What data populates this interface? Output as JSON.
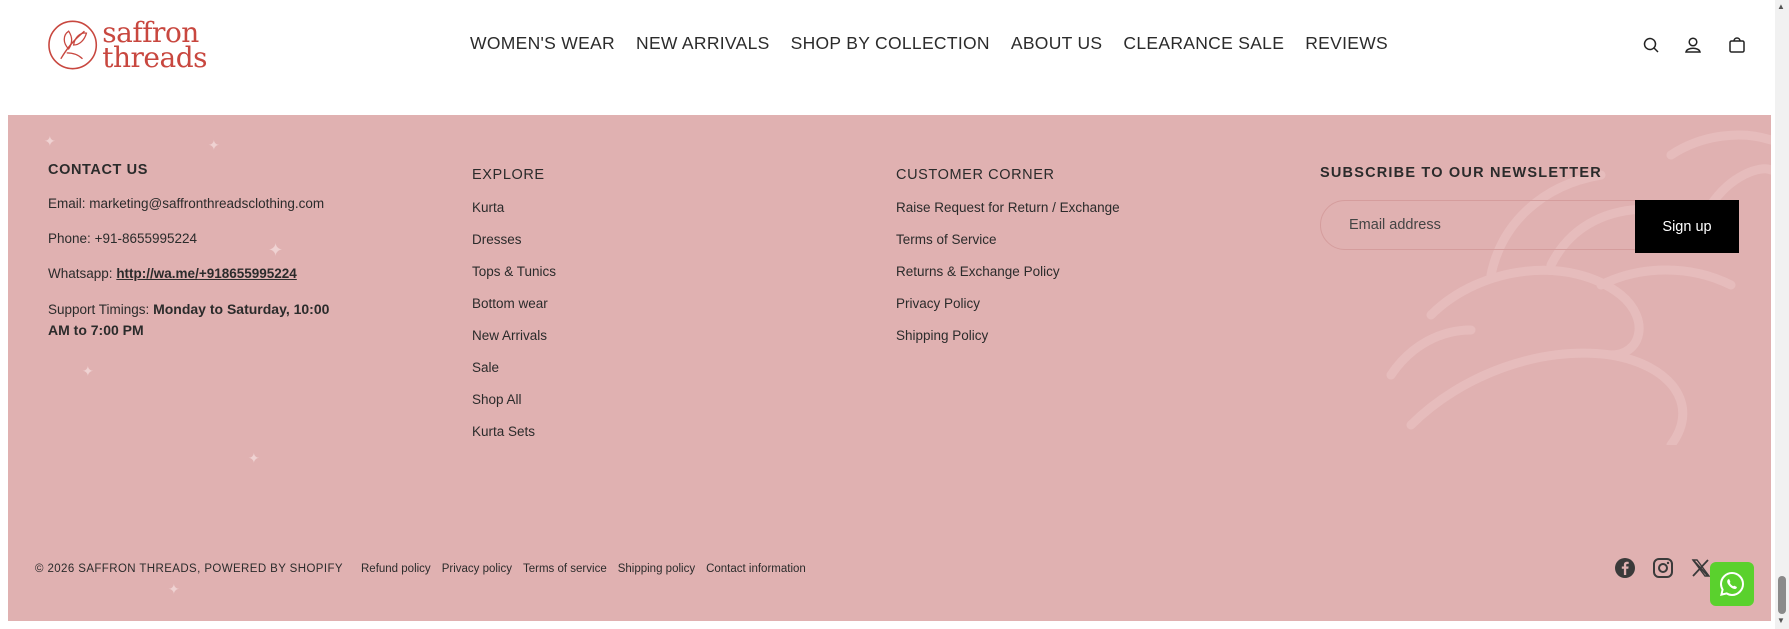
{
  "brand": {
    "line1": "saffron",
    "line2": "threads",
    "color": "#c8473f"
  },
  "nav": [
    "WOMEN'S WEAR",
    "NEW ARRIVALS",
    "SHOP BY COLLECTION",
    "ABOUT US",
    "CLEARANCE SALE",
    "REVIEWS"
  ],
  "header_icons": [
    "search-icon",
    "account-icon",
    "cart-icon"
  ],
  "contact": {
    "title": "CONTACT US",
    "email_label": "Email:",
    "email": "marketing@saffronthreadsclothing.com",
    "phone_label": "Phone:",
    "phone": "+91-8655995224",
    "whatsapp_label": "Whatsapp:",
    "whatsapp_link": "http://wa.me/+918655995224",
    "timings_label": "Support Timings:",
    "timings": "Monday to Saturday, 10:00 AM to 7:00 PM"
  },
  "explore": {
    "title": "EXPLORE",
    "links": [
      "Kurta",
      "Dresses",
      "Tops & Tunics",
      "Bottom wear",
      "New Arrivals",
      "Sale",
      "Shop All",
      "Kurta Sets"
    ]
  },
  "customer_corner": {
    "title": "CUSTOMER CORNER",
    "links": [
      "Raise Request for Return / Exchange",
      "Terms of Service",
      "Returns & Exchange Policy",
      "Privacy Policy",
      "Shipping Policy"
    ]
  },
  "newsletter": {
    "title": "SUBSCRIBE TO OUR NEWSLETTER",
    "placeholder": "Email address",
    "button": "Sign up"
  },
  "bottom": {
    "copyright": "© 2026 SAFFRON THREADS, POWERED BY SHOPIFY",
    "policies": [
      "Refund policy",
      "Privacy policy",
      "Terms of service",
      "Shipping policy",
      "Contact information"
    ],
    "social": [
      "facebook-icon",
      "instagram-icon",
      "x-icon"
    ]
  },
  "colors": {
    "footer_bg": "#e0b1b1",
    "whatsapp": "#5ad12d",
    "button": "#000000"
  }
}
